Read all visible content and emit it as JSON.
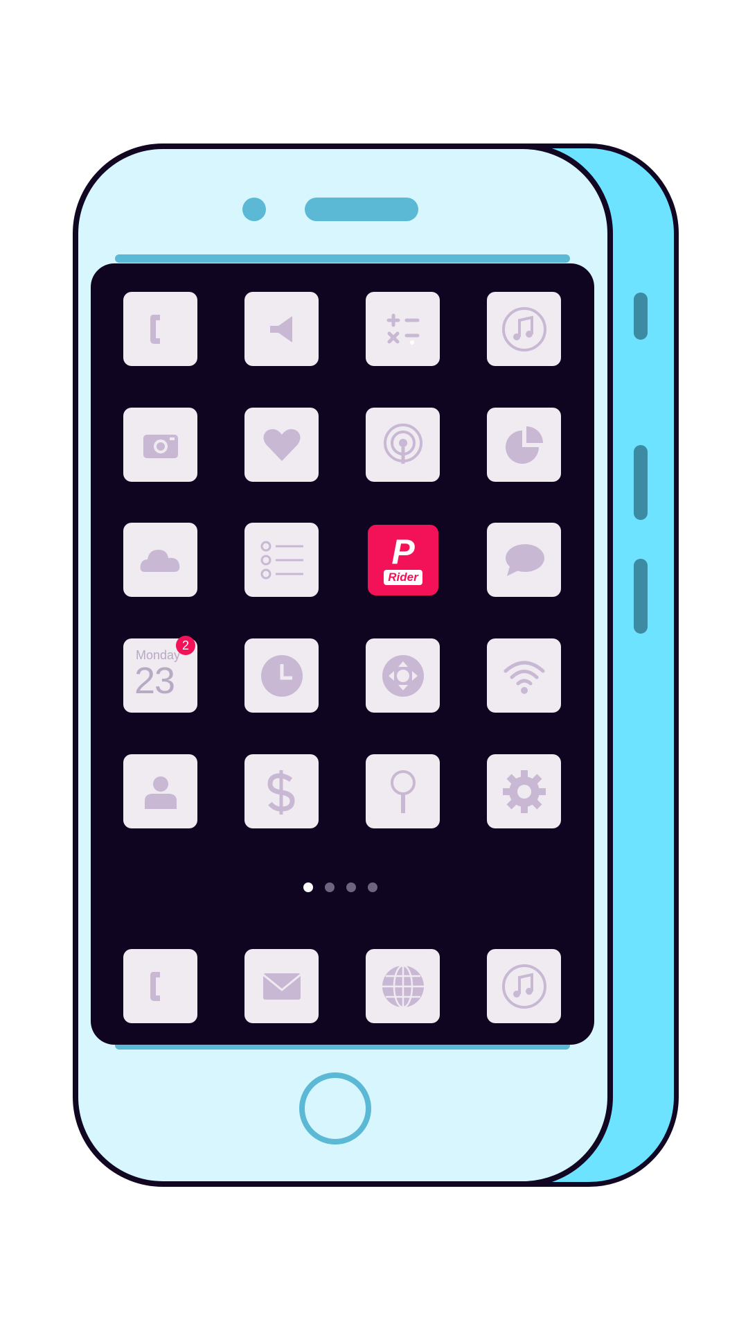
{
  "screen": {
    "rider_app": {
      "letter": "P",
      "label": "Rider",
      "color": "#f31258"
    },
    "calendar": {
      "day_name": "Monday",
      "date": "23",
      "badge_count": "2"
    },
    "page_indicator": {
      "pages": 4,
      "active": 1
    },
    "icons": [
      "phone-icon",
      "megaphone-icon",
      "calculator-icon",
      "music-icon",
      "camera-icon",
      "heart-icon",
      "podcast-icon",
      "pie-chart-icon",
      "cloud-icon",
      "list-icon",
      "rider-app-icon",
      "chat-icon",
      "calendar-icon",
      "clock-icon",
      "gamepad-icon",
      "wifi-icon",
      "contacts-icon",
      "dollar-icon",
      "search-icon",
      "gear-icon"
    ],
    "dock": [
      "phone-icon",
      "mail-icon",
      "globe-icon",
      "music-icon"
    ]
  },
  "colors": {
    "screen": "#100520",
    "phone_front": "#d8f6fd",
    "phone_side": "#6ee3ff",
    "accent": "#5bb9d6",
    "icon_tile": "#efebf1",
    "icon_glyph": "#b8a9c4"
  }
}
